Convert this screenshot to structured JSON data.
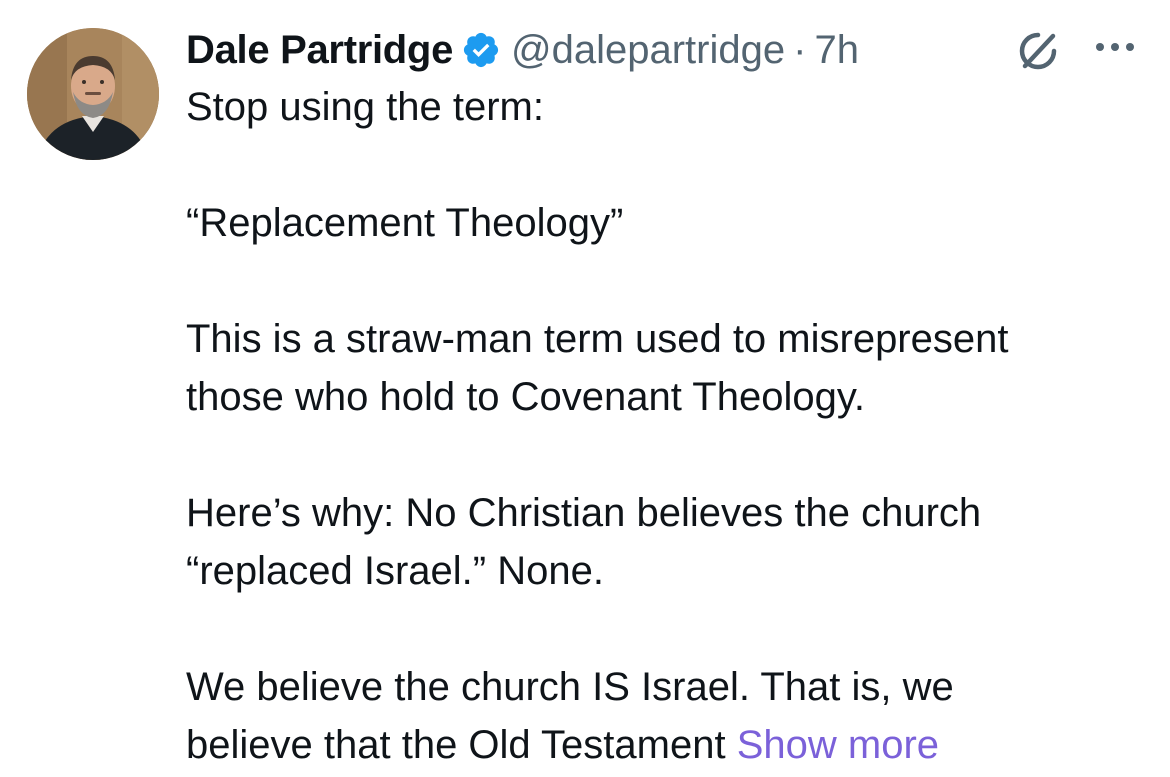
{
  "author": {
    "display_name": "Dale Partridge",
    "handle": "@dalepartridge",
    "separator": "·",
    "time": "7h",
    "verified": true
  },
  "tweet": {
    "line1": "Stop using the term:",
    "line2": "“Replacement Theology”",
    "line3": "This is a straw-man term used to misrepresent",
    "line4": "those who hold to Covenant Theology.",
    "line5": "Here’s why: No Christian believes the church",
    "line6": "“replaced Israel.” None.",
    "line7": "We believe the church IS Israel. That is, we",
    "line8": "believe that the Old Testament",
    "show_more": "Show more"
  },
  "icons": {
    "verified": "verified-badge-icon",
    "grok": "grok-icon",
    "more": "more-options-icon"
  },
  "colors": {
    "text_primary": "#0f1419",
    "text_secondary": "#536471",
    "verified_blue": "#1d9bf0",
    "link": "#7b61d9"
  }
}
